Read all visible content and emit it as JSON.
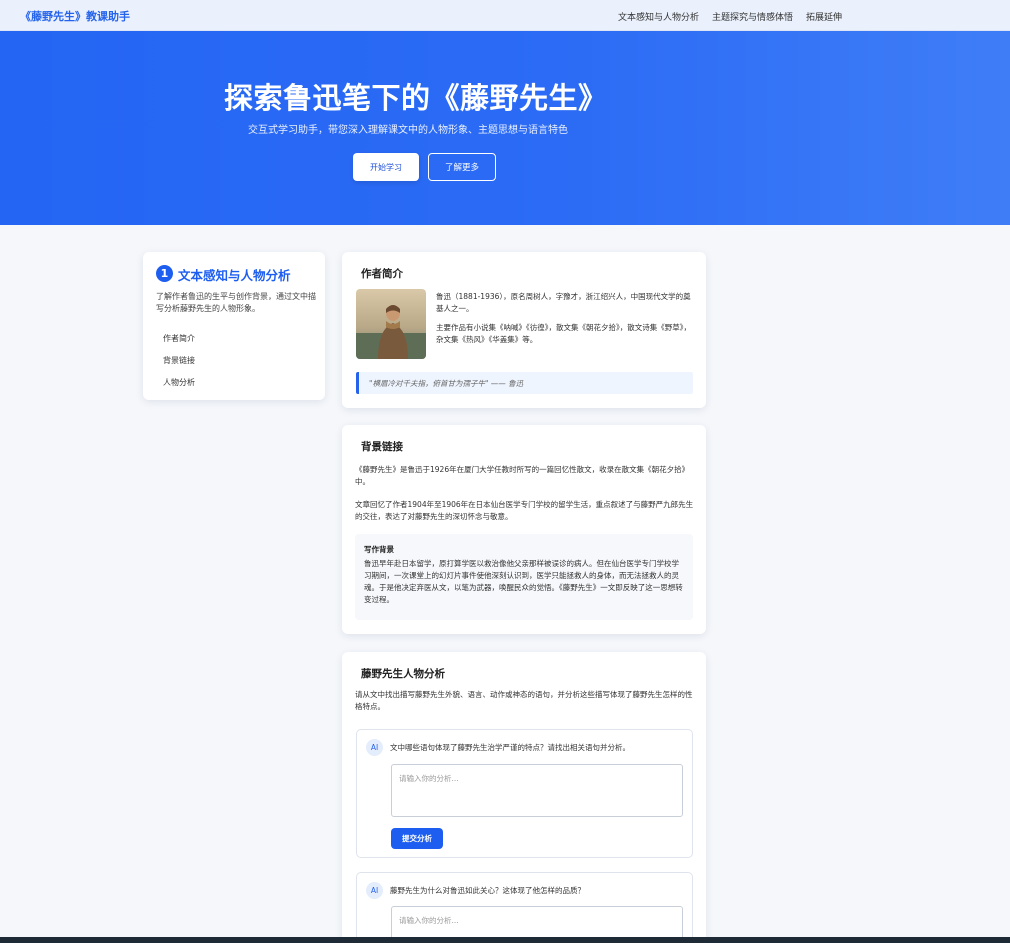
{
  "nav": {
    "brand": "《藤野先生》教课助手",
    "links": [
      "文本感知与人物分析",
      "主题探究与情感体悟",
      "拓展延伸"
    ]
  },
  "hero": {
    "title": "探索鲁迅笔下的《藤野先生》",
    "subtitle": "交互式学习助手，带您深入理解课文中的人物形象、主题思想与语言特色",
    "start_label": "开始学习",
    "more_label": "了解更多"
  },
  "sidebar": {
    "number": "1",
    "title": "文本感知与人物分析",
    "desc": "了解作者鲁迅的生平与创作背景，通过文中描写分析藤野先生的人物形象。",
    "items": [
      "作者简介",
      "背景链接",
      "人物分析"
    ]
  },
  "author": {
    "heading": "作者简介",
    "p1": "鲁迅（1881-1936），原名周树人，字豫才，浙江绍兴人，中国现代文学的奠基人之一。",
    "p2": "主要作品有小说集《呐喊》《彷徨》，散文集《朝花夕拾》，散文诗集《野草》，杂文集《热风》《华盖集》等。",
    "quote": "\"横眉冷对千夫指，俯首甘为孺子牛\" —— 鲁迅"
  },
  "background": {
    "heading": "背景链接",
    "p1": "《藤野先生》是鲁迅于1926年在厦门大学任教时所写的一篇回忆性散文，收录在散文集《朝花夕拾》中。",
    "p2": "文章回忆了作者1904年至1906年在日本仙台医学专门学校的留学生活，重点叙述了与藤野严九郎先生的交往，表达了对藤野先生的深切怀念与敬意。",
    "box_title": "写作背景",
    "box_text": "鲁迅早年赴日本留学，原打算学医以救治像他父亲那样被误诊的病人。但在仙台医学专门学校学习期间，一次课堂上的幻灯片事件使他深刻认识到，医学只能拯救人的身体，而无法拯救人的灵魂。于是他决定弃医从文，以笔为武器，唤醒民众的觉悟。《藤野先生》一文即反映了这一思想转变过程。"
  },
  "analysis": {
    "heading": "藤野先生人物分析",
    "intro": "请从文中找出描写藤野先生外貌、语言、动作或神态的语句，并分析这些描写体现了藤野先生怎样的性格特点。",
    "questions": [
      {
        "ai": "AI",
        "text": "文中哪些语句体现了藤野先生治学严谨的特点？请找出相关语句并分析。",
        "placeholder": "请输入你的分析...",
        "submit": "提交分析"
      },
      {
        "ai": "AI",
        "text": "藤野先生为什么对鲁迅如此关心？这体现了他怎样的品质？",
        "placeholder": "请输入你的分析..."
      }
    ]
  },
  "colors": {
    "accent": "#1d5ef0",
    "hero": "#2b6bf5"
  }
}
